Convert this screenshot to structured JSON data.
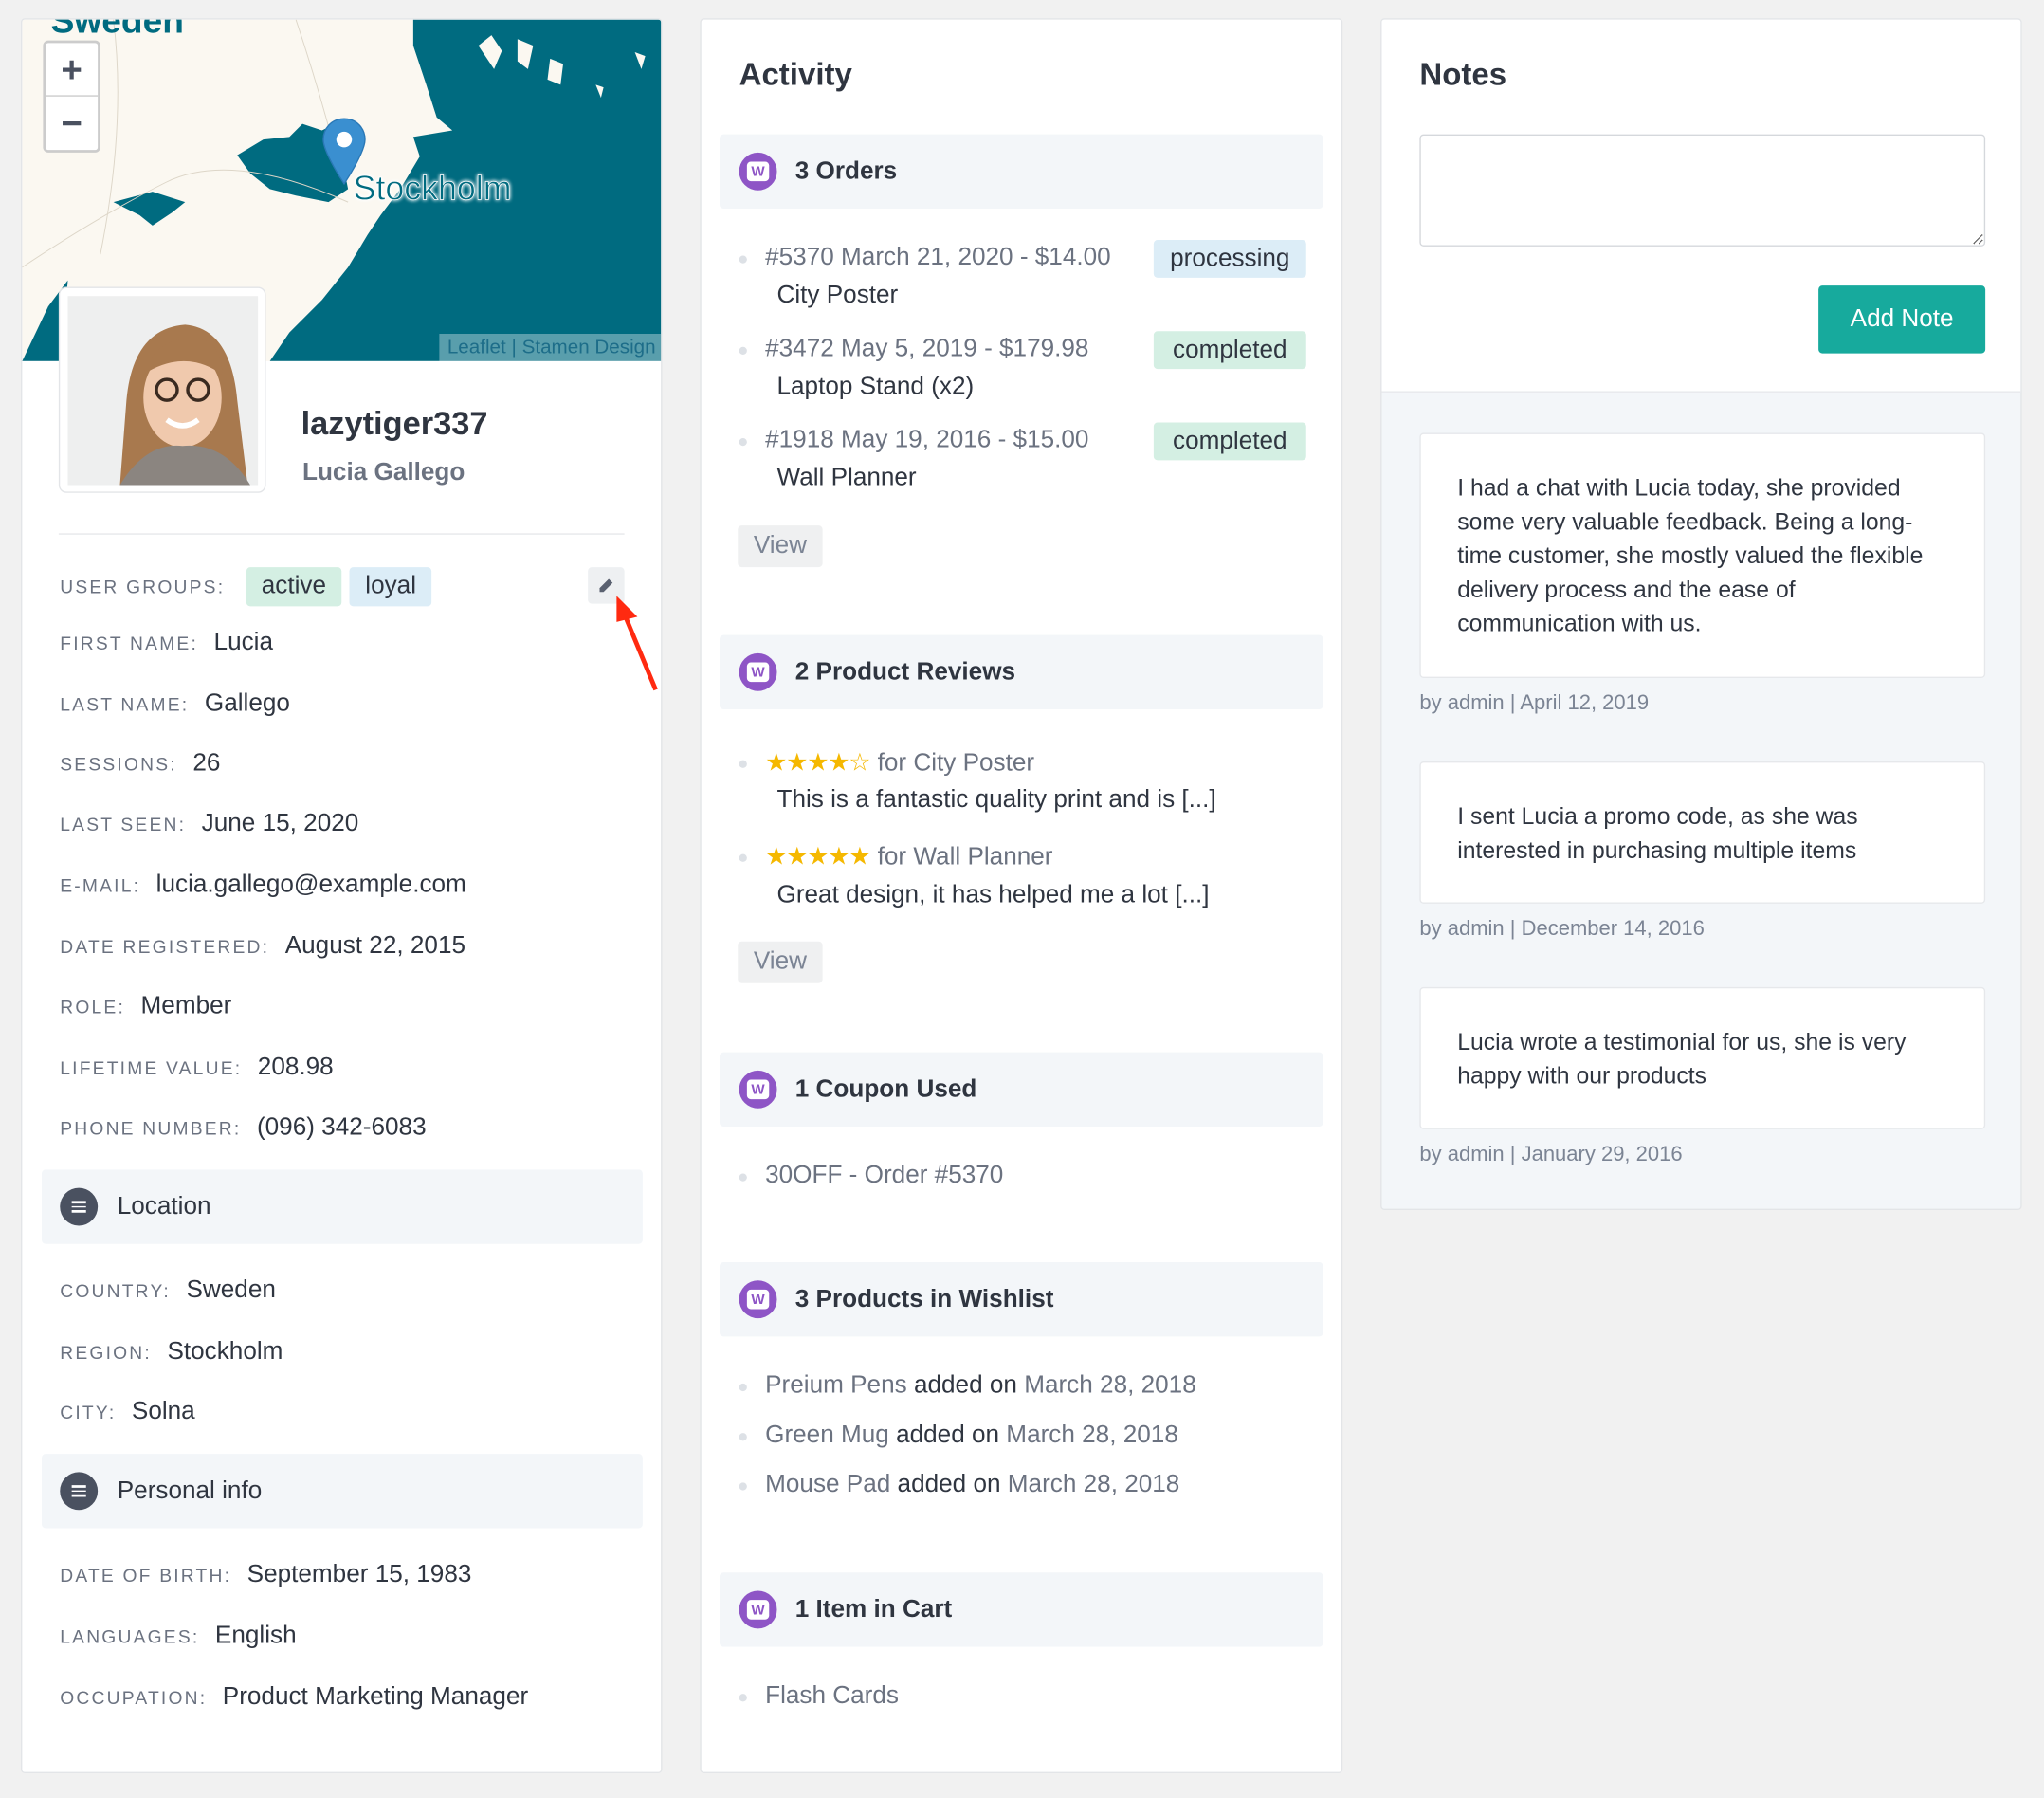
{
  "map": {
    "country_label": "Sweden",
    "city_label": "Stockholm",
    "zoom_in": "+",
    "zoom_out": "−",
    "attribution_leaflet": "Leaflet",
    "attribution_sep": "|",
    "attribution_stamen": "Stamen Design",
    "colors": {
      "water": "#006b80",
      "land": "#fbf8f1"
    }
  },
  "profile": {
    "username": "lazytiger337",
    "full_name": "Lucia Gallego",
    "user_groups_label": "User groups:",
    "groups": [
      "active",
      "loyal"
    ],
    "fields": [
      {
        "label": "First name:",
        "value": "Lucia"
      },
      {
        "label": "Last name:",
        "value": "Gallego"
      },
      {
        "label": "Sessions:",
        "value": "26"
      },
      {
        "label": "Last seen:",
        "value": "June 15, 2020"
      },
      {
        "label": "E-mail:",
        "value": "lucia.gallego@example.com"
      },
      {
        "label": "Date registered:",
        "value": "August 22, 2015"
      },
      {
        "label": "Role:",
        "value": "Member"
      },
      {
        "label": "Lifetime value:",
        "value": "208.98"
      },
      {
        "label": "Phone number:",
        "value": "(096) 342-6083"
      }
    ],
    "location": {
      "title": "Location",
      "fields": [
        {
          "label": "Country:",
          "value": "Sweden"
        },
        {
          "label": "Region:",
          "value": "Stockholm"
        },
        {
          "label": "City:",
          "value": "Solna"
        }
      ]
    },
    "personal": {
      "title": "Personal info",
      "fields": [
        {
          "label": "Date of birth:",
          "value": "September 15, 1983"
        },
        {
          "label": "Languages:",
          "value": "English"
        },
        {
          "label": "Occupation:",
          "value": "Product Marketing Manager"
        }
      ]
    }
  },
  "activity": {
    "title": "Activity",
    "orders": {
      "title": "3 Orders",
      "items": [
        {
          "line": "#5370 March 21, 2020 - $14.00",
          "product": "City Poster",
          "status": "processing"
        },
        {
          "line": "#3472 May 5, 2019 - $179.98",
          "product": "Laptop Stand (x2)",
          "status": "completed"
        },
        {
          "line": "#1918 May 19, 2016 - $15.00",
          "product": "Wall Planner",
          "status": "completed"
        }
      ],
      "view": "View"
    },
    "reviews": {
      "title": "2 Product Reviews",
      "items": [
        {
          "rating": 4,
          "stars": "★★★★☆",
          "target": "for City Poster",
          "text": "This is a fantastic quality print and is [...]"
        },
        {
          "rating": 5,
          "stars": "★★★★★",
          "target": "for Wall Planner",
          "text": "Great design, it has helped me a lot [...]"
        }
      ],
      "view": "View"
    },
    "coupons": {
      "title": "1 Coupon Used",
      "items": [
        "30OFF - Order #5370"
      ]
    },
    "wishlist": {
      "title": "3 Products in Wishlist",
      "items": [
        {
          "product": "Preium Pens",
          "action": "added on",
          "date": "March 28, 2018"
        },
        {
          "product": "Green Mug",
          "action": "added on",
          "date": "March 28, 2018"
        },
        {
          "product": "Mouse Pad",
          "action": "added on",
          "date": "March 28, 2018"
        }
      ]
    },
    "cart": {
      "title": "1 Item in Cart",
      "items": [
        "Flash Cards"
      ]
    },
    "colors": {
      "processing": "#dcedf7",
      "completed": "#d4efe3",
      "icon": "#8e55c6"
    }
  },
  "notes": {
    "title": "Notes",
    "textarea_value": "",
    "add_button": "Add Note",
    "button_color": "#17aa9d",
    "items": [
      {
        "text": "I had a chat with Lucia today, she provided some very valuable feedback. Being a long-time customer, she mostly valued the flexible delivery process and the ease of communication with us.",
        "meta": "by admin | April 12, 2019"
      },
      {
        "text": "I sent Lucia a promo code, as she was interested in purchasing multiple items",
        "meta": "by admin | December 14, 2016"
      },
      {
        "text": "Lucia wrote a testimonial for us, she is very happy with our products",
        "meta": "by admin | January 29, 2016"
      }
    ]
  }
}
